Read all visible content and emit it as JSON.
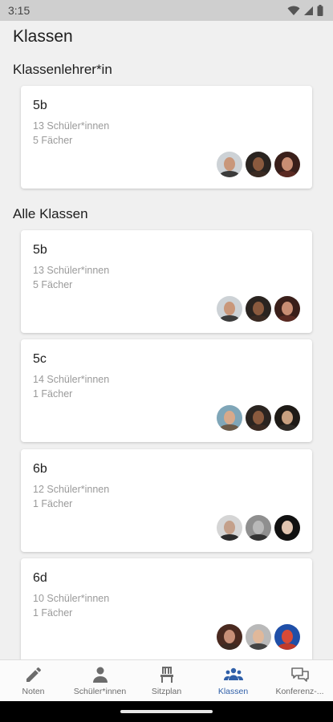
{
  "status_bar": {
    "time": "3:15",
    "icons": [
      "wifi-icon",
      "signal-icon",
      "battery-icon"
    ]
  },
  "page_title": "Klassen",
  "sections": [
    {
      "title": "Klassenlehrer*in",
      "cards": [
        {
          "name": "5b",
          "students": "13 Schüler*innen",
          "subjects": "5 Fächer",
          "avatars": [
            "teacher-avatar",
            "teacher-avatar",
            "teacher-avatar"
          ]
        }
      ]
    },
    {
      "title": "Alle Klassen",
      "cards": [
        {
          "name": "5b",
          "students": "13 Schüler*innen",
          "subjects": "5 Fächer",
          "avatars": [
            "teacher-avatar",
            "teacher-avatar",
            "teacher-avatar"
          ]
        },
        {
          "name": "5c",
          "students": "14 Schüler*innen",
          "subjects": "1 Fächer",
          "avatars": [
            "teacher-avatar",
            "teacher-avatar",
            "teacher-avatar"
          ]
        },
        {
          "name": "6b",
          "students": "12 Schüler*innen",
          "subjects": "1 Fächer",
          "avatars": [
            "teacher-avatar",
            "teacher-avatar",
            "teacher-avatar"
          ]
        },
        {
          "name": "6d",
          "students": "10 Schüler*innen",
          "subjects": "1 Fächer",
          "avatars": [
            "teacher-avatar",
            "teacher-avatar",
            "teacher-avatar"
          ]
        }
      ]
    }
  ],
  "bottom_nav": [
    {
      "label": "Noten",
      "icon": "pencil-icon",
      "active": false
    },
    {
      "label": "Schüler*innen",
      "icon": "person-icon",
      "active": false
    },
    {
      "label": "Sitzplan",
      "icon": "chair-icon",
      "active": false
    },
    {
      "label": "Klassen",
      "icon": "group-icon",
      "active": true
    },
    {
      "label": "Konferenz-...",
      "icon": "chat-icon",
      "active": false
    }
  ],
  "colors": {
    "active": "#2f5fa8",
    "inactive": "#6c6c6c",
    "card": "#ffffff",
    "background": "#f0f0f0"
  }
}
